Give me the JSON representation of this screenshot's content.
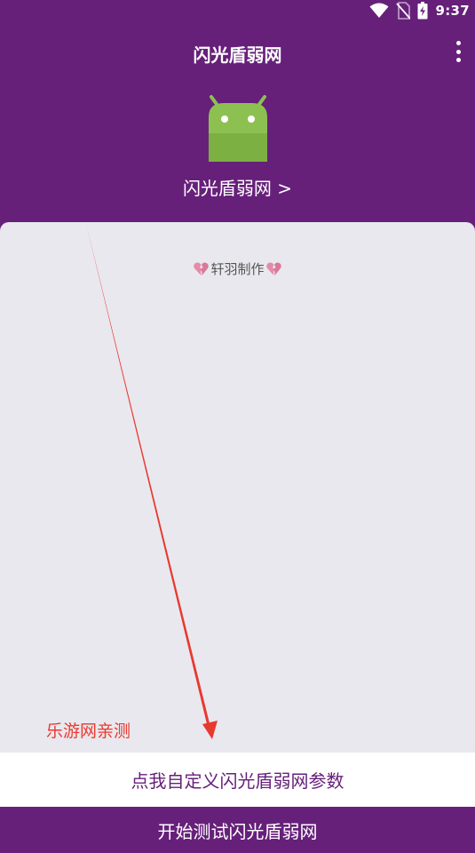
{
  "status_bar": {
    "time": "9:37",
    "icons": [
      "wifi-icon",
      "no-sim-icon",
      "battery-charging-icon"
    ]
  },
  "app_bar": {
    "title": "闪光盾弱网",
    "menu_icon": "overflow-menu-icon"
  },
  "header": {
    "logo_icon": "android-robot-icon",
    "subtitle": "闪光盾弱网 >"
  },
  "card": {
    "credit": "轩羽制作",
    "credit_icon": "broken-heart-icon"
  },
  "watermark": {
    "text": "乐游网亲测",
    "color": "#e8392f"
  },
  "actions": {
    "custom_params": "点我自定义闪光盾弱网参数",
    "start_test": "开始测试闪光盾弱网"
  },
  "colors": {
    "primary": "#66207a",
    "card_bg": "#e9e8ee",
    "android_green": "#8cc152"
  }
}
